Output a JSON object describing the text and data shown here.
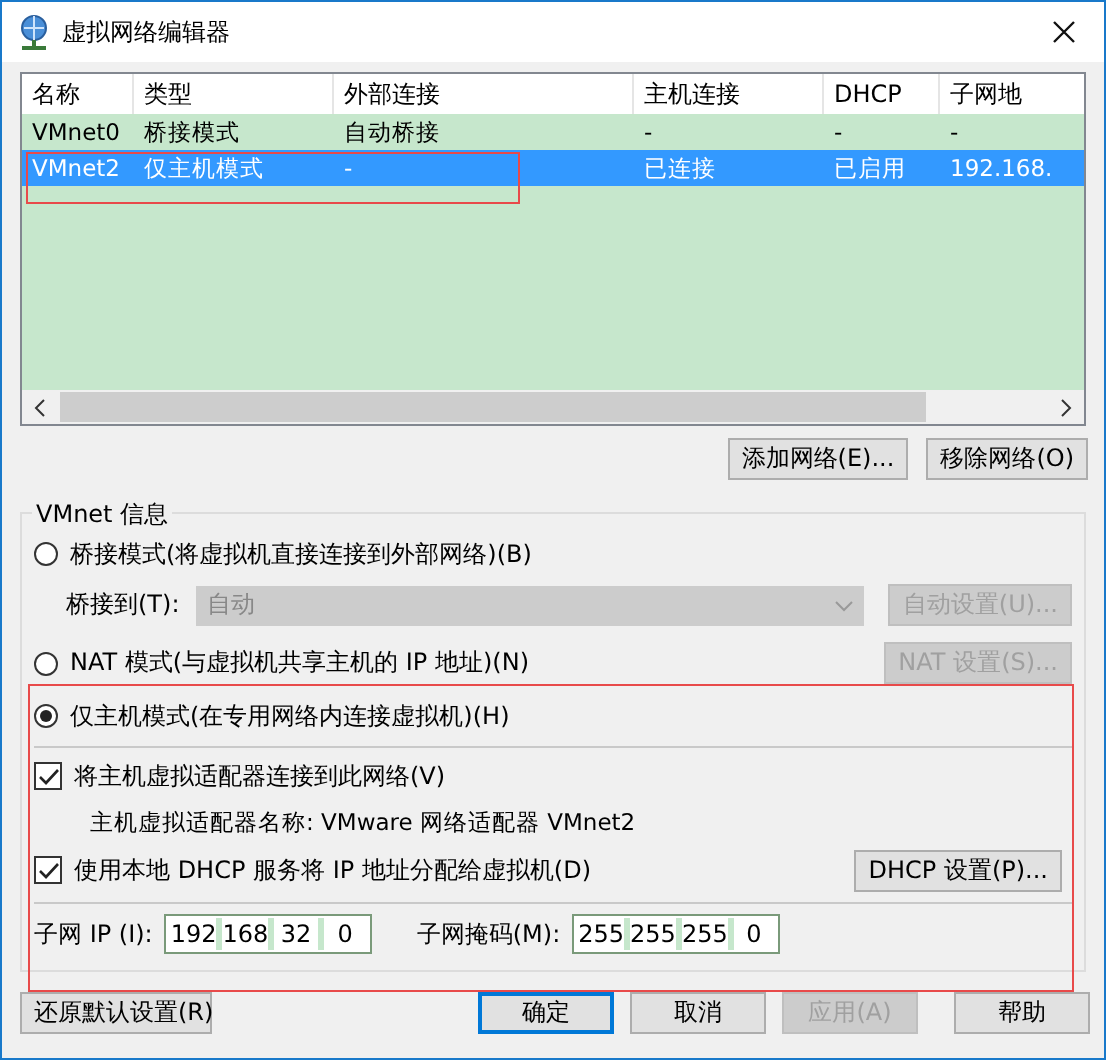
{
  "window": {
    "title": "虚拟网络编辑器"
  },
  "table": {
    "columns": [
      "名称",
      "类型",
      "外部连接",
      "主机连接",
      "DHCP",
      "子网地"
    ],
    "rows": [
      {
        "cells": [
          "VMnet0",
          "桥接模式",
          "自动桥接",
          "-",
          "-",
          "-"
        ],
        "selected": false
      },
      {
        "cells": [
          "VMnet2",
          "仅主机模式",
          "-",
          "已连接",
          "已启用",
          "192.168."
        ],
        "selected": true
      }
    ]
  },
  "list_buttons": [
    "添加网络(E)...",
    "移除网络(O)"
  ],
  "vmnet_info": {
    "title": "VMnet 信息",
    "bridged": {
      "label": "桥接模式(将虚拟机直接连接到外部网络)(B)",
      "selected": false,
      "bridge_to_label": "桥接到(T):",
      "bridge_to_value": "自动",
      "bridge_to_disabled": true,
      "button": "自动设置(U)...",
      "button_disabled": true
    },
    "nat": {
      "label": "NAT 模式(与虚拟机共享主机的 IP 地址)(N)",
      "selected": false,
      "button": "NAT 设置(S)...",
      "button_disabled": true
    },
    "host_only": {
      "label": "仅主机模式(在专用网络内连接虚拟机)(H)",
      "selected": true
    },
    "connect_adapter": {
      "label": "将主机虚拟适配器连接到此网络(V)",
      "checked": true
    },
    "adapter_name": "主机虚拟适配器名称: VMware 网络适配器 VMnet2",
    "dhcp": {
      "label": "使用本地 DHCP 服务将 IP 地址分配给虚拟机(D)",
      "checked": true,
      "button": "DHCP 设置(P)..."
    },
    "subnet_ip": {
      "label": "子网 IP (I):",
      "octets": [
        "192",
        "168",
        "32",
        "0"
      ]
    },
    "subnet_mask": {
      "label": "子网掩码(M):",
      "octets": [
        "255",
        "255",
        "255",
        "0"
      ]
    }
  },
  "footer_buttons": [
    {
      "label": "还原默认设置(R)",
      "default": false,
      "disabled": false
    },
    {
      "label": "确定",
      "default": true,
      "disabled": false
    },
    {
      "label": "取消",
      "default": false,
      "disabled": false
    },
    {
      "label": "应用(A)",
      "default": false,
      "disabled": true
    },
    {
      "label": "帮助",
      "default": false,
      "disabled": false
    }
  ]
}
